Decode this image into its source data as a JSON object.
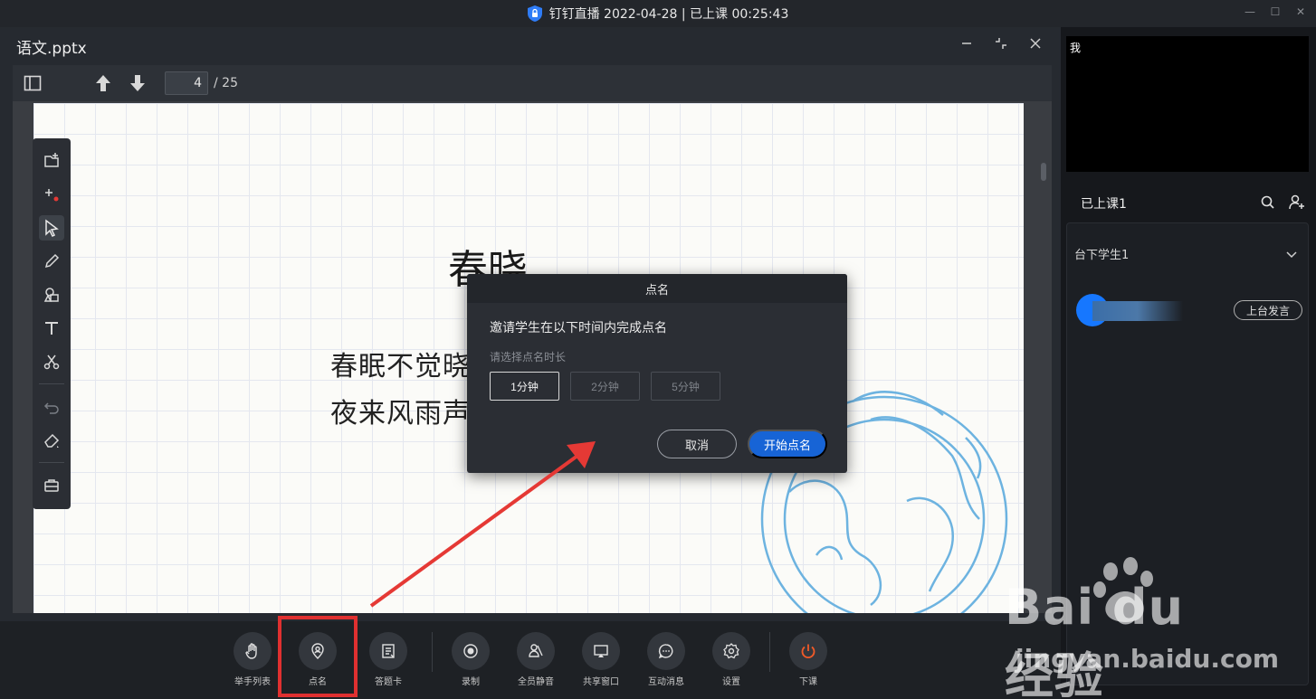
{
  "titlebar": {
    "title": "钉钉直播 2022-04-28 | 已上课 00:25:43"
  },
  "document": {
    "title": "语文.pptx",
    "page_current": "4",
    "page_total": "/ 25"
  },
  "slide": {
    "title": "春晓",
    "line1": "春眠不觉晓",
    "line2": "夜来风雨声"
  },
  "toolbar": {
    "items": [
      {
        "label": "举手列表",
        "icon": "raise-hand-icon"
      },
      {
        "label": "点名",
        "icon": "roll-call-icon"
      },
      {
        "label": "答题卡",
        "icon": "answer-card-icon"
      },
      {
        "label": "录制",
        "icon": "record-icon"
      },
      {
        "label": "全员静音",
        "icon": "mute-all-icon"
      },
      {
        "label": "共享窗口",
        "icon": "share-window-icon"
      },
      {
        "label": "互动消息",
        "icon": "message-icon"
      },
      {
        "label": "设置",
        "icon": "gear-icon"
      },
      {
        "label": "下课",
        "icon": "power-icon"
      }
    ],
    "end_color": "#f05a28"
  },
  "right_panel": {
    "self_label": "我",
    "class_title": "已上课1",
    "students_section": "台下学生1",
    "speak_button": "上台发言"
  },
  "modal": {
    "title": "点名",
    "description": "邀请学生在以下时间内完成点名",
    "hint": "请选择点名时长",
    "durations": [
      "1分钟",
      "2分钟",
      "5分钟"
    ],
    "selected_index": 0,
    "cancel": "取消",
    "start": "开始点名",
    "accent": "#1764d6"
  },
  "annotation": {
    "highlight_color": "#e03030"
  },
  "watermark": {
    "brand": "Bai du 经验",
    "url": "jingyan.baidu.com"
  }
}
